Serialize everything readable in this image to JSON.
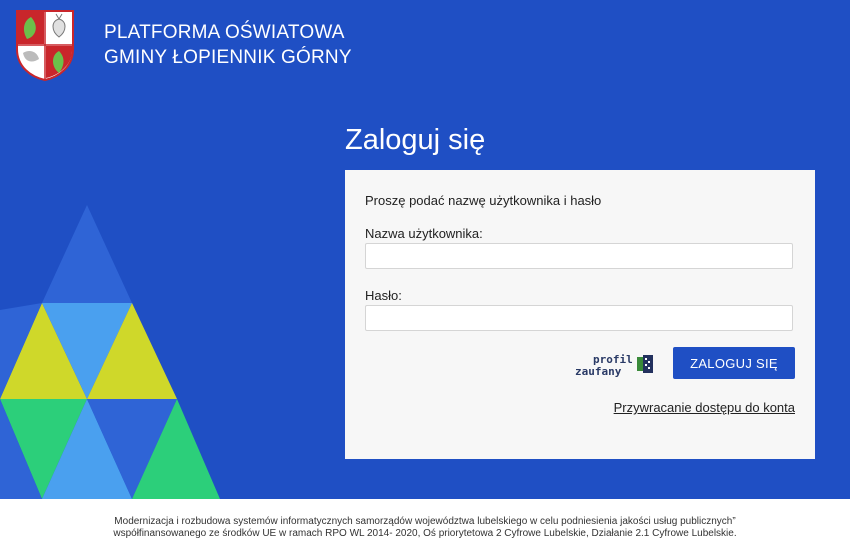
{
  "brand": {
    "line1": "PLATFORMA OŚWIATOWA",
    "line2": "GMINY ŁOPIENNIK GÓRNY",
    "logo_icon": "coat-of-arms-icon"
  },
  "login": {
    "title": "Zaloguj się",
    "prompt": "Proszę podać nazwę użytkownika i hasło",
    "username_label": "Nazwa użytkownika:",
    "username_value": "",
    "password_label": "Hasło:",
    "password_value": "",
    "submit_label": "ZALOGUJ SIĘ",
    "profil_zaufany_line1": "profil",
    "profil_zaufany_line2": "zaufany",
    "restore_link": "Przywracanie dostępu do konta"
  },
  "footer": {
    "line1": "Modernizacja i rozbudowa systemów informatycznych samorządów województwa lubelskiego w celu podniesienia jakości usług publicznych”",
    "line2": "współfinansowanego ze środków UE w ramach RPO WL 2014- 2020, Oś priorytetowa 2 Cyfrowe Lubelskie, Działanie 2.1 Cyfrowe Lubelskie."
  },
  "colors": {
    "background": "#1f4fc4",
    "button": "#1f4fc4",
    "card": "#f7f7f7",
    "tri_dark": "#2f64d6",
    "tri_light": "#4aa0ef",
    "tri_yellow": "#cfd82a",
    "tri_green": "#2ccf7a"
  }
}
